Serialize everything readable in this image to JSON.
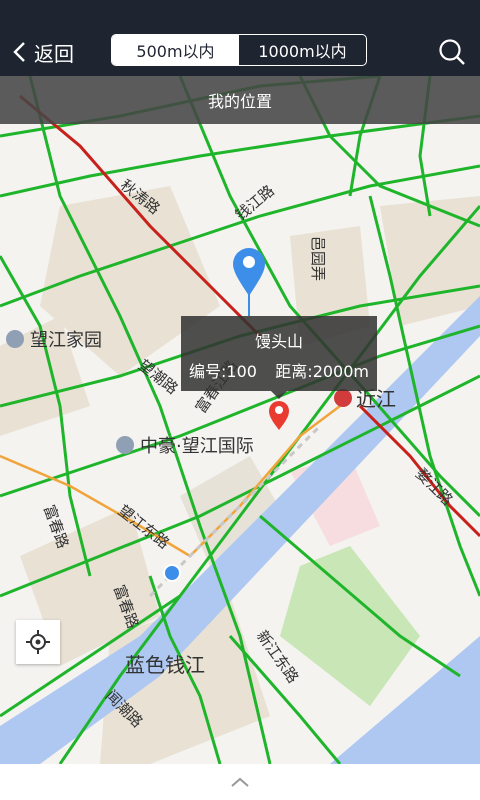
{
  "header": {
    "back_label": "返回",
    "segments": [
      {
        "label": "500m以内",
        "active": true
      },
      {
        "label": "1000m以内",
        "active": false
      }
    ],
    "search_icon": "search-icon"
  },
  "location_bar": {
    "label": "我的位置"
  },
  "map": {
    "pois": [
      {
        "label": "望江家园",
        "icon": "building-icon"
      },
      {
        "label": "中豪·望江国际",
        "icon": "building-icon"
      },
      {
        "label": "近江",
        "icon": "metro-icon"
      },
      {
        "label": "蓝色钱江"
      }
    ],
    "roads": [
      "秋涛路",
      "钱江路",
      "邑园弄",
      "婺江路",
      "望潮路",
      "富春江路",
      "富春路",
      "望江东路",
      "富春路",
      "新江东路",
      "闻潮路",
      "婺江路"
    ],
    "popup": {
      "title": "馒头山",
      "number_label": "编号:100",
      "distance_label": "距离:2000m"
    },
    "colors": {
      "road_green": "#1fb52b",
      "road_red": "#c8201a",
      "road_orange": "#f0a43a",
      "river": "#aec8f2",
      "marker_blue": "#3d8ee8",
      "marker_red": "#e93b2f"
    }
  },
  "footer": {
    "expand_icon": "chevron-up-icon"
  }
}
